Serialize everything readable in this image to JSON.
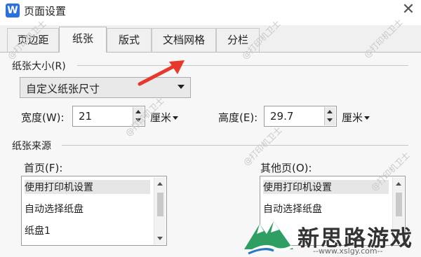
{
  "window": {
    "title": "页面设置",
    "app_icon_letter": "W"
  },
  "tabs": [
    {
      "label": "页边距"
    },
    {
      "label": "纸张"
    },
    {
      "label": "版式"
    },
    {
      "label": "文档网格"
    },
    {
      "label": "分栏"
    }
  ],
  "paper_size": {
    "section_label": "纸张大小(R)",
    "selected": "自定义纸张尺寸"
  },
  "width": {
    "label": "宽度(W):",
    "value": "21",
    "unit": "厘米"
  },
  "height": {
    "label": "高度(E):",
    "value": "29.7",
    "unit": "厘米"
  },
  "paper_source": {
    "section_label": "纸张来源",
    "first_page": {
      "label": "首页(F):",
      "items": [
        "使用打印机设置",
        "自动选择纸盘",
        "纸盘1"
      ]
    },
    "other_pages": {
      "label": "其他页(O):",
      "items": [
        "使用打印机设置",
        "自动选择纸盘"
      ]
    }
  },
  "watermark_text": "@打印机卫士",
  "brand": {
    "name": "新思路游戏",
    "url": "--www.xslgy.com--"
  },
  "colors": {
    "annotation_arrow": "#e8382c",
    "app_icon": "#2b6fe0",
    "brand_green": "#2f9e63"
  }
}
